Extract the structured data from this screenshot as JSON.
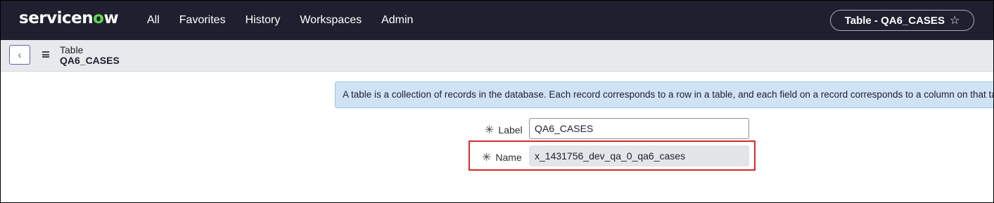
{
  "brand": {
    "logo_pre": "servicen",
    "logo_o": "o",
    "logo_post": "w",
    "accent": "#62d84e"
  },
  "nav": {
    "items": [
      {
        "label": "All"
      },
      {
        "label": "Favorites"
      },
      {
        "label": "History"
      },
      {
        "label": "Workspaces"
      },
      {
        "label": "Admin"
      }
    ],
    "context_pill": {
      "label": "Table - QA6_CASES",
      "icon": "star-icon"
    }
  },
  "subheader": {
    "back_icon": "chevron-left-icon",
    "menu_icon": "hamburger-icon",
    "record_type": "Table",
    "record_name": "QA6_CASES"
  },
  "form": {
    "info_message": "A table is a collection of records in the database. Each record corresponds to a row in a table, and each field on a record corresponds to a column on that table.",
    "fields": {
      "label": {
        "label": "Label",
        "value": "QA6_CASES",
        "required": true
      },
      "name": {
        "label": "Name",
        "value": "x_1431756_dev_qa_0_qa6_cases",
        "required": true,
        "readonly": true
      }
    },
    "required_mark": "✳",
    "highlight_color": "#d52b2b"
  }
}
